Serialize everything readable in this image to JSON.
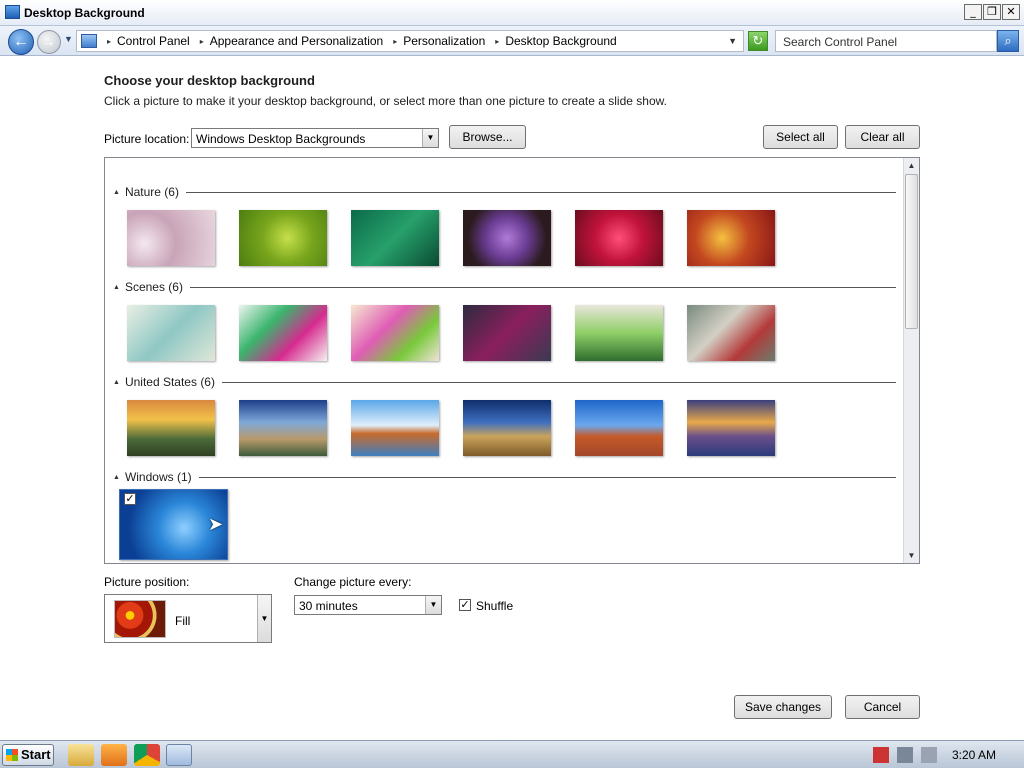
{
  "window": {
    "title": "Desktop Background",
    "controls": [
      "_",
      "❐",
      "✕"
    ]
  },
  "address": {
    "crumbs": [
      "Control Panel",
      "Appearance and Personalization",
      "Personalization",
      "Desktop Background"
    ],
    "search_placeholder": "Search Control Panel"
  },
  "page": {
    "heading": "Choose your desktop background",
    "subtext": "Click a picture to make it your desktop background, or select more than one picture to create a slide show.",
    "location_label": "Picture location:",
    "location_value": "Windows Desktop Backgrounds",
    "browse_label": "Browse...",
    "select_all_label": "Select all",
    "clear_all_label": "Clear all"
  },
  "gallery": {
    "groups": [
      {
        "name": "Nature (6)",
        "thumbs": [
          "radial-gradient(circle at 20% 60%, #f4e8f0, #c9a4b8 40%, #e9d7df)",
          "radial-gradient(circle at 55% 50%, #c6e04a, #78a51c 45%, #4d7d12)",
          "linear-gradient(135deg, #0b6b4a, #27a06b 50%, #0a4b33)",
          "radial-gradient(circle at 50% 50%, #b07bd8, #6a3c93 40%, #2b1b1f 75%)",
          "radial-gradient(circle at 50% 50%, #ff4f7a, #c2133c 45%, #6b0d1d)",
          "radial-gradient(circle at 40% 50%, #f5c140, #c34820 45%, #8a1616)"
        ]
      },
      {
        "name": "Scenes (6)",
        "thumbs": [
          "linear-gradient(135deg, #e9efe4, #8fc7c4 50%, #dfe7d8)",
          "linear-gradient(135deg, #ecf5f0, #3ab46d 35%, #d62a8f 65%, #f6f2f0)",
          "linear-gradient(135deg, #f5e9d0, #e05db5 40%, #78c93a 70%, #f1e2d8)",
          "linear-gradient(135deg, #2d2b3e, #8b1f5e 50%, #3a3a52)",
          "linear-gradient(180deg, #e9e6da, #8fcf67 50%, #2f6e2e)",
          "linear-gradient(135deg, #7a8a7f, #d3d0c5 40%, #b43a3a 70%, #6a7d6c)"
        ]
      },
      {
        "name": "United States (6)",
        "thumbs": [
          "linear-gradient(180deg, #d9883f, #f2c14a 35%, #4b6b3a 70%, #2f3f22)",
          "linear-gradient(180deg, #1d3f8a, #7fa8d8 40%, #b89a6a 70%, #3d5a3a)",
          "linear-gradient(180deg, #5aa7e8, #dfeefb 45%, #c86a2a 60%, #3f7fc0)",
          "linear-gradient(180deg, #0f2e6b, #3e6fbf 40%, #caa45b 65%, #7d5a2a)",
          "linear-gradient(180deg, #1f66c8, #6aa8ee 45%, #c65a2a 65%, #a3472a)",
          "linear-gradient(180deg, #3a3f7d, #e8a94a 40%, #6a4f8a 65%, #2b3a7a)"
        ]
      },
      {
        "name": "Windows (1)",
        "thumbs": [
          "radial-gradient(circle at 60% 55%, #8fd0ff, #2a86d8 35%, #0b3f94 75%)"
        ]
      }
    ]
  },
  "options": {
    "position_label": "Picture position:",
    "position_value": "Fill",
    "interval_label": "Change picture every:",
    "interval_value": "30 minutes",
    "shuffle_label": "Shuffle",
    "shuffle_checked": true
  },
  "footer": {
    "save_label": "Save changes",
    "cancel_label": "Cancel"
  },
  "taskbar": {
    "start_label": "Start",
    "clock": "3:20 AM"
  }
}
